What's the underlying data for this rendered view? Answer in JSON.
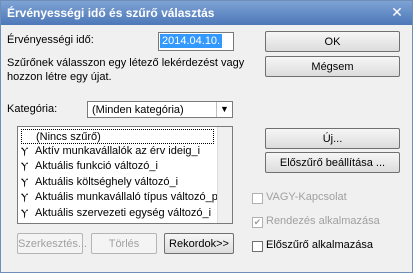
{
  "window": {
    "title": "Érvényességi idő és szűrő választás",
    "close_label": "✕"
  },
  "validity": {
    "label": "Érvényességi idő:",
    "value": "2014.04.10."
  },
  "info_text_line1": "Szűrőnek válasszon egy létező lekérdezést vagy",
  "info_text_line2": "hozzon létre egy újat.",
  "category": {
    "label": "Kategória:",
    "selected": "(Minden kategória)"
  },
  "filter_list": {
    "items": [
      {
        "label": "(Nincs szűrő)",
        "icon": ""
      },
      {
        "label": "Aktív munkavállalók az érv ideig_i",
        "icon": "filter-icon"
      },
      {
        "label": "Aktuális funkció változó_i",
        "icon": "filter-icon"
      },
      {
        "label": "Aktuális költséghely változó_i",
        "icon": "filter-icon"
      },
      {
        "label": "Aktuális munkavállaló típus változó_p",
        "icon": "filter-icon"
      },
      {
        "label": "Aktuális szervezeti egység változó_i",
        "icon": "filter-icon"
      }
    ]
  },
  "buttons": {
    "ok": "OK",
    "cancel": "Mégsem",
    "new": "Új...",
    "prefilter_settings": "Előszűrő beállítása ...",
    "edit": "Szerkesztés...",
    "delete": "Törlés",
    "records": "Rekordok>>"
  },
  "checkboxes": {
    "or_connection": {
      "label": "VAGY-Kapcsolat",
      "checked": false,
      "enabled": false
    },
    "apply_order": {
      "label": "Rendezés alkalmazása",
      "checked": true,
      "enabled": false
    },
    "apply_prefilter": {
      "label": "Előszűrő alkalmazása",
      "checked": false,
      "enabled": true
    }
  }
}
